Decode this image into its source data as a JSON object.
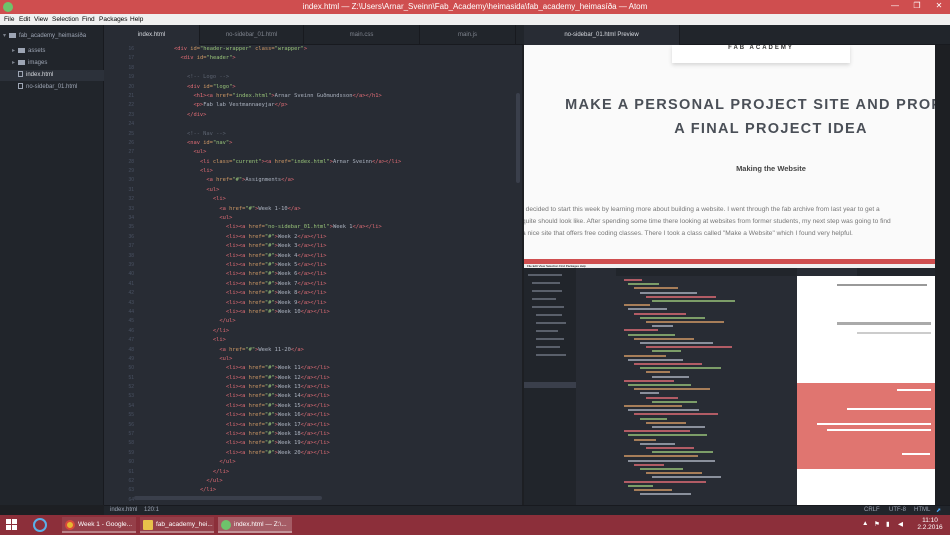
{
  "window": {
    "title": "index.html — Z:\\Users\\Arnar_Sveinn\\Fab_Academy\\heimasida\\fab_academy_heimasíða — Atom",
    "minimize": "—",
    "maximize": "❐",
    "close": "✕"
  },
  "menu": [
    "File",
    "Edit",
    "View",
    "Selection",
    "Find",
    "Packages",
    "Help"
  ],
  "tree": {
    "root": "fab_academy_heimasíða",
    "items": [
      "assets",
      "images",
      "index.html",
      "no-sidebar_01.html"
    ]
  },
  "tabs": [
    "index.html",
    "no-sidebar_01.html",
    "main.css",
    "main.js",
    "no-sidebar_01.html Preview"
  ],
  "editor": {
    "first_line": 16,
    "lines": [
      [
        [
          "        ",
          ""
        ],
        [
          "<div ",
          "tg"
        ],
        [
          "id=",
          "at"
        ],
        [
          "\"header-wrapper\" ",
          "st"
        ],
        [
          "class=",
          "at"
        ],
        [
          "\"wrapper\"",
          "st"
        ],
        [
          ">",
          "tg"
        ]
      ],
      [
        [
          "          ",
          ""
        ],
        [
          "<div ",
          "tg"
        ],
        [
          "id=",
          "at"
        ],
        [
          "\"header\"",
          "st"
        ],
        [
          ">",
          "tg"
        ]
      ],
      [
        [
          "",
          ""
        ]
      ],
      [
        [
          "            ",
          ""
        ],
        [
          "<!-- Logo -->",
          "cm"
        ]
      ],
      [
        [
          "            ",
          ""
        ],
        [
          "<div ",
          "tg"
        ],
        [
          "id=",
          "at"
        ],
        [
          "\"logo\"",
          "st"
        ],
        [
          ">",
          "tg"
        ]
      ],
      [
        [
          "              ",
          ""
        ],
        [
          "<h1>",
          "tg"
        ],
        [
          "<a ",
          "tg"
        ],
        [
          "href=",
          "at"
        ],
        [
          "\"index.html\"",
          "st"
        ],
        [
          ">",
          "tg"
        ],
        [
          "Arnar Sveinn Guðmundsson",
          ""
        ],
        [
          "</a></h1>",
          "tg"
        ]
      ],
      [
        [
          "              ",
          ""
        ],
        [
          "<p>",
          "tg"
        ],
        [
          "Fab lab Vestmannaeyjar",
          ""
        ],
        [
          "</p>",
          "tg"
        ]
      ],
      [
        [
          "            ",
          ""
        ],
        [
          "</div>",
          "tg"
        ]
      ],
      [
        [
          "",
          ""
        ]
      ],
      [
        [
          "            ",
          ""
        ],
        [
          "<!-- Nav -->",
          "cm"
        ]
      ],
      [
        [
          "            ",
          ""
        ],
        [
          "<nav ",
          "tg"
        ],
        [
          "id=",
          "at"
        ],
        [
          "\"nav\"",
          "st"
        ],
        [
          ">",
          "tg"
        ]
      ],
      [
        [
          "              ",
          ""
        ],
        [
          "<ul>",
          "tg"
        ]
      ],
      [
        [
          "                ",
          ""
        ],
        [
          "<li ",
          "tg"
        ],
        [
          "class=",
          "at"
        ],
        [
          "\"current\"",
          "st"
        ],
        [
          "><a ",
          "tg"
        ],
        [
          "href=",
          "at"
        ],
        [
          "\"index.html\"",
          "st"
        ],
        [
          ">",
          "tg"
        ],
        [
          "Arnar Sveinn",
          ""
        ],
        [
          "</a></li>",
          "tg"
        ]
      ],
      [
        [
          "                ",
          ""
        ],
        [
          "<li>",
          "tg"
        ]
      ],
      [
        [
          "                  ",
          ""
        ],
        [
          "<a ",
          "tg"
        ],
        [
          "href=",
          "at"
        ],
        [
          "\"#\"",
          "st"
        ],
        [
          ">",
          "tg"
        ],
        [
          "Assignments",
          ""
        ],
        [
          "</a>",
          "tg"
        ]
      ],
      [
        [
          "                  ",
          ""
        ],
        [
          "<ul>",
          "tg"
        ]
      ],
      [
        [
          "                    ",
          ""
        ],
        [
          "<li>",
          "tg"
        ]
      ],
      [
        [
          "                      ",
          ""
        ],
        [
          "<a ",
          "tg"
        ],
        [
          "href=",
          "at"
        ],
        [
          "\"#\"",
          "st"
        ],
        [
          ">",
          "tg"
        ],
        [
          "Week 1-10",
          ""
        ],
        [
          "</a>",
          "tg"
        ]
      ],
      [
        [
          "                      ",
          ""
        ],
        [
          "<ul>",
          "tg"
        ]
      ],
      [
        [
          "                        ",
          ""
        ],
        [
          "<li><a ",
          "tg"
        ],
        [
          "href=",
          "at"
        ],
        [
          "\"no-sidebar_01.html\"",
          "st"
        ],
        [
          ">",
          "tg"
        ],
        [
          "Week 1",
          ""
        ],
        [
          "</a></li>",
          "tg"
        ]
      ],
      [
        [
          "                        ",
          ""
        ],
        [
          "<li><a ",
          "tg"
        ],
        [
          "href=",
          "at"
        ],
        [
          "\"#\"",
          "st"
        ],
        [
          ">",
          "tg"
        ],
        [
          "Week 2",
          ""
        ],
        [
          "</a></li>",
          "tg"
        ]
      ],
      [
        [
          "                        ",
          ""
        ],
        [
          "<li><a ",
          "tg"
        ],
        [
          "href=",
          "at"
        ],
        [
          "\"#\"",
          "st"
        ],
        [
          ">",
          "tg"
        ],
        [
          "Week 3",
          ""
        ],
        [
          "</a></li>",
          "tg"
        ]
      ],
      [
        [
          "                        ",
          ""
        ],
        [
          "<li><a ",
          "tg"
        ],
        [
          "href=",
          "at"
        ],
        [
          "\"#\"",
          "st"
        ],
        [
          ">",
          "tg"
        ],
        [
          "Week 4",
          ""
        ],
        [
          "</a></li>",
          "tg"
        ]
      ],
      [
        [
          "                        ",
          ""
        ],
        [
          "<li><a ",
          "tg"
        ],
        [
          "href=",
          "at"
        ],
        [
          "\"#\"",
          "st"
        ],
        [
          ">",
          "tg"
        ],
        [
          "Week 5",
          ""
        ],
        [
          "</a></li>",
          "tg"
        ]
      ],
      [
        [
          "                        ",
          ""
        ],
        [
          "<li><a ",
          "tg"
        ],
        [
          "href=",
          "at"
        ],
        [
          "\"#\"",
          "st"
        ],
        [
          ">",
          "tg"
        ],
        [
          "Week 6",
          ""
        ],
        [
          "</a></li>",
          "tg"
        ]
      ],
      [
        [
          "                        ",
          ""
        ],
        [
          "<li><a ",
          "tg"
        ],
        [
          "href=",
          "at"
        ],
        [
          "\"#\"",
          "st"
        ],
        [
          ">",
          "tg"
        ],
        [
          "Week 7",
          ""
        ],
        [
          "</a></li>",
          "tg"
        ]
      ],
      [
        [
          "                        ",
          ""
        ],
        [
          "<li><a ",
          "tg"
        ],
        [
          "href=",
          "at"
        ],
        [
          "\"#\"",
          "st"
        ],
        [
          ">",
          "tg"
        ],
        [
          "Week 8",
          ""
        ],
        [
          "</a></li>",
          "tg"
        ]
      ],
      [
        [
          "                        ",
          ""
        ],
        [
          "<li><a ",
          "tg"
        ],
        [
          "href=",
          "at"
        ],
        [
          "\"#\"",
          "st"
        ],
        [
          ">",
          "tg"
        ],
        [
          "Week 9",
          ""
        ],
        [
          "</a></li>",
          "tg"
        ]
      ],
      [
        [
          "                        ",
          ""
        ],
        [
          "<li><a ",
          "tg"
        ],
        [
          "href=",
          "at"
        ],
        [
          "\"#\"",
          "st"
        ],
        [
          ">",
          "tg"
        ],
        [
          "Week 10",
          ""
        ],
        [
          "</a></li>",
          "tg"
        ]
      ],
      [
        [
          "                      ",
          ""
        ],
        [
          "</ul>",
          "tg"
        ]
      ],
      [
        [
          "                    ",
          ""
        ],
        [
          "</li>",
          "tg"
        ]
      ],
      [
        [
          "                    ",
          ""
        ],
        [
          "<li>",
          "tg"
        ]
      ],
      [
        [
          "                      ",
          ""
        ],
        [
          "<a ",
          "tg"
        ],
        [
          "href=",
          "at"
        ],
        [
          "\"#\"",
          "st"
        ],
        [
          ">",
          "tg"
        ],
        [
          "Week 11-20",
          ""
        ],
        [
          "</a>",
          "tg"
        ]
      ],
      [
        [
          "                      ",
          ""
        ],
        [
          "<ul>",
          "tg"
        ]
      ],
      [
        [
          "                        ",
          ""
        ],
        [
          "<li><a ",
          "tg"
        ],
        [
          "href=",
          "at"
        ],
        [
          "\"#\"",
          "st"
        ],
        [
          ">",
          "tg"
        ],
        [
          "Week 11",
          ""
        ],
        [
          "</a></li>",
          "tg"
        ]
      ],
      [
        [
          "                        ",
          ""
        ],
        [
          "<li><a ",
          "tg"
        ],
        [
          "href=",
          "at"
        ],
        [
          "\"#\"",
          "st"
        ],
        [
          ">",
          "tg"
        ],
        [
          "Week 12",
          ""
        ],
        [
          "</a></li>",
          "tg"
        ]
      ],
      [
        [
          "                        ",
          ""
        ],
        [
          "<li><a ",
          "tg"
        ],
        [
          "href=",
          "at"
        ],
        [
          "\"#\"",
          "st"
        ],
        [
          ">",
          "tg"
        ],
        [
          "Week 13",
          ""
        ],
        [
          "</a></li>",
          "tg"
        ]
      ],
      [
        [
          "                        ",
          ""
        ],
        [
          "<li><a ",
          "tg"
        ],
        [
          "href=",
          "at"
        ],
        [
          "\"#\"",
          "st"
        ],
        [
          ">",
          "tg"
        ],
        [
          "Week 14",
          ""
        ],
        [
          "</a></li>",
          "tg"
        ]
      ],
      [
        [
          "                        ",
          ""
        ],
        [
          "<li><a ",
          "tg"
        ],
        [
          "href=",
          "at"
        ],
        [
          "\"#\"",
          "st"
        ],
        [
          ">",
          "tg"
        ],
        [
          "Week 15",
          ""
        ],
        [
          "</a></li>",
          "tg"
        ]
      ],
      [
        [
          "                        ",
          ""
        ],
        [
          "<li><a ",
          "tg"
        ],
        [
          "href=",
          "at"
        ],
        [
          "\"#\"",
          "st"
        ],
        [
          ">",
          "tg"
        ],
        [
          "Week 16",
          ""
        ],
        [
          "</a></li>",
          "tg"
        ]
      ],
      [
        [
          "                        ",
          ""
        ],
        [
          "<li><a ",
          "tg"
        ],
        [
          "href=",
          "at"
        ],
        [
          "\"#\"",
          "st"
        ],
        [
          ">",
          "tg"
        ],
        [
          "Week 17",
          ""
        ],
        [
          "</a></li>",
          "tg"
        ]
      ],
      [
        [
          "                        ",
          ""
        ],
        [
          "<li><a ",
          "tg"
        ],
        [
          "href=",
          "at"
        ],
        [
          "\"#\"",
          "st"
        ],
        [
          ">",
          "tg"
        ],
        [
          "Week 18",
          ""
        ],
        [
          "</a></li>",
          "tg"
        ]
      ],
      [
        [
          "                        ",
          ""
        ],
        [
          "<li><a ",
          "tg"
        ],
        [
          "href=",
          "at"
        ],
        [
          "\"#\"",
          "st"
        ],
        [
          ">",
          "tg"
        ],
        [
          "Week 19",
          ""
        ],
        [
          "</a></li>",
          "tg"
        ]
      ],
      [
        [
          "                        ",
          ""
        ],
        [
          "<li><a ",
          "tg"
        ],
        [
          "href=",
          "at"
        ],
        [
          "\"#\"",
          "st"
        ],
        [
          ">",
          "tg"
        ],
        [
          "Week 20",
          ""
        ],
        [
          "</a></li>",
          "tg"
        ]
      ],
      [
        [
          "                      ",
          ""
        ],
        [
          "</ul>",
          "tg"
        ]
      ],
      [
        [
          "                    ",
          ""
        ],
        [
          "</li>",
          "tg"
        ]
      ],
      [
        [
          "                  ",
          ""
        ],
        [
          "</ul>",
          "tg"
        ]
      ],
      [
        [
          "                ",
          ""
        ],
        [
          "</li>",
          "tg"
        ]
      ],
      [
        [
          "",
          ""
        ]
      ]
    ]
  },
  "preview": {
    "banner": "FAB ACADEMY",
    "heading_line1": "MAKE A PERSONAL PROJECT SITE AND PROPOSE",
    "heading_line2": "A FINAL PROJECT IDEA",
    "subheading": "Making the Website",
    "paragraph": [
      "I decided to start this week by learning more about building a website. I went through the fab archive from last year to get a",
      "quite should look like. After spending some time there looking at websites from former students, my next step was going to find",
      "a nice site that offers free coding classes. There I took a class called \"Make a Website\" which I found very helpful."
    ]
  },
  "statusbar": {
    "file": "index.html",
    "cursor": "120:1",
    "line_ending": "CRLF",
    "encoding": "UTF-8",
    "grammar": "HTML"
  },
  "taskbar": {
    "items": [
      "Week 1 - Google...",
      "fab_academy_hei...",
      "index.html — Z:\\..."
    ],
    "time": "11:10",
    "date": "2.2.2016"
  },
  "colors": {
    "accent_red": "#cf4e4f",
    "taskbar": "#8c2f3a",
    "editor_bg": "#282c34",
    "tree_bg": "#21252b",
    "preview_coral": "#e07570"
  }
}
